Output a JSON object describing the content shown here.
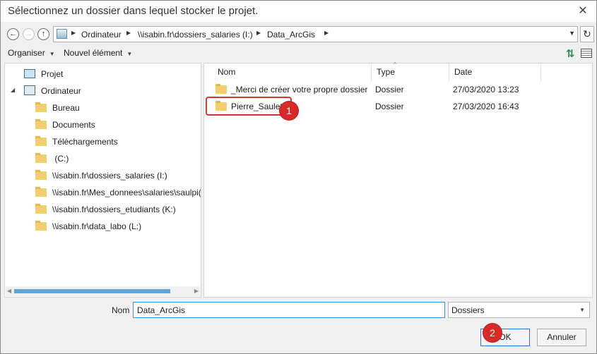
{
  "dialog": {
    "title": "Sélectionnez un dossier dans lequel stocker le projet.",
    "close_label": "✕"
  },
  "navigation": {
    "back": "←",
    "forward": "→",
    "up": "↑",
    "breadcrumbs": [
      "Ordinateur",
      "\\\\isabin.fr\\dossiers_salaries (I:)",
      "Data_ArcGis"
    ],
    "separator": "▶",
    "dropdown": "▼",
    "refresh": "↻"
  },
  "toolbar": {
    "organize": "Organiser",
    "new_item": "Nouvel élément",
    "arrow": "▼",
    "sort_icon": "⇅"
  },
  "tree": [
    {
      "label": "Projet",
      "icon": "project-icon"
    },
    {
      "label": "Ordinateur",
      "icon": "computer-icon",
      "expander": "◢"
    },
    {
      "label": "Bureau",
      "icon": "folder-icon"
    },
    {
      "label": "Documents",
      "icon": "folder-icon"
    },
    {
      "label": "Téléchargements",
      "icon": "folder-icon"
    },
    {
      "label": " (C:)",
      "icon": "folder-icon"
    },
    {
      "label": "\\\\isabin.fr\\dossiers_salaries (I:)",
      "icon": "folder-icon"
    },
    {
      "label": "\\\\isabin.fr\\Mes_donnees\\salaries\\saulpi(",
      "icon": "folder-icon"
    },
    {
      "label": "\\\\isabin.fr\\dossiers_etudiants (K:)",
      "icon": "folder-icon"
    },
    {
      "label": "\\\\isabin.fr\\data_labo (L:)",
      "icon": "folder-icon"
    }
  ],
  "scroll": {
    "left": "◀",
    "right": "▶"
  },
  "columns": {
    "name": "Nom",
    "type": "Type",
    "date": "Date",
    "chevron": "^"
  },
  "files": [
    {
      "name": "_Merci de créer votre propre dossier",
      "type": "Dossier",
      "date": "27/03/2020 13:23"
    },
    {
      "name": "Pierre_Saulet",
      "type": "Dossier",
      "date": "27/03/2020 16:43"
    }
  ],
  "footer": {
    "name_label": "Nom",
    "name_value": "Data_ArcGis",
    "type_value": "Dossiers",
    "type_arrow": "▼",
    "ok_label": "OK",
    "cancel_label": "Annuler"
  },
  "annotations": {
    "badge_1": "1",
    "badge_2": "2",
    "highlight_color": "#e03232"
  }
}
